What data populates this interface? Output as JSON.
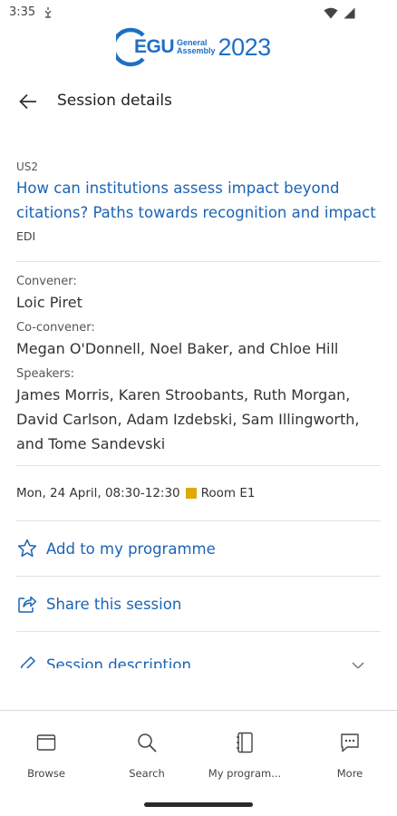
{
  "status_bar": {
    "time": "3:35"
  },
  "logo": {
    "brand": "EGU",
    "line1": "General",
    "line2": "Assembly",
    "year": "2023",
    "color": "#1f6fc4"
  },
  "header": {
    "title": "Session details",
    "back_icon": "arrow-left-icon"
  },
  "session": {
    "code": "US2",
    "title": "How can institutions assess impact beyond citations? Paths towards recognition and impact",
    "tag": "EDI",
    "title_color": "#1a64b5"
  },
  "people": {
    "convener_label": "Convener:",
    "convener": "Loic Piret",
    "coconvener_label": "Co-convener:",
    "coconveners": "Megan O'Donnell, Noel Baker, and Chloe Hill",
    "speakers_label": "Speakers:",
    "speakers": "James Morris, Karen Stroobants, Ruth Morgan, David Carlson, Adam Izdebski, Sam Illingworth, and Tome Sandevski"
  },
  "schedule": {
    "datetime": "Mon, 24 April, 08:30-12:30",
    "room": "Room E1",
    "room_color": "#e0a800"
  },
  "actions": [
    {
      "label": "Add to my programme",
      "icon": "star-outline-icon"
    },
    {
      "label": "Share this session",
      "icon": "share-icon"
    },
    {
      "label": "Session description",
      "icon": "pencil-icon"
    }
  ],
  "bottom_nav": [
    {
      "label": "Browse",
      "icon": "browse-window-icon"
    },
    {
      "label": "Search",
      "icon": "search-icon"
    },
    {
      "label": "My program...",
      "icon": "notebook-icon"
    },
    {
      "label": "More",
      "icon": "chat-more-icon"
    }
  ]
}
